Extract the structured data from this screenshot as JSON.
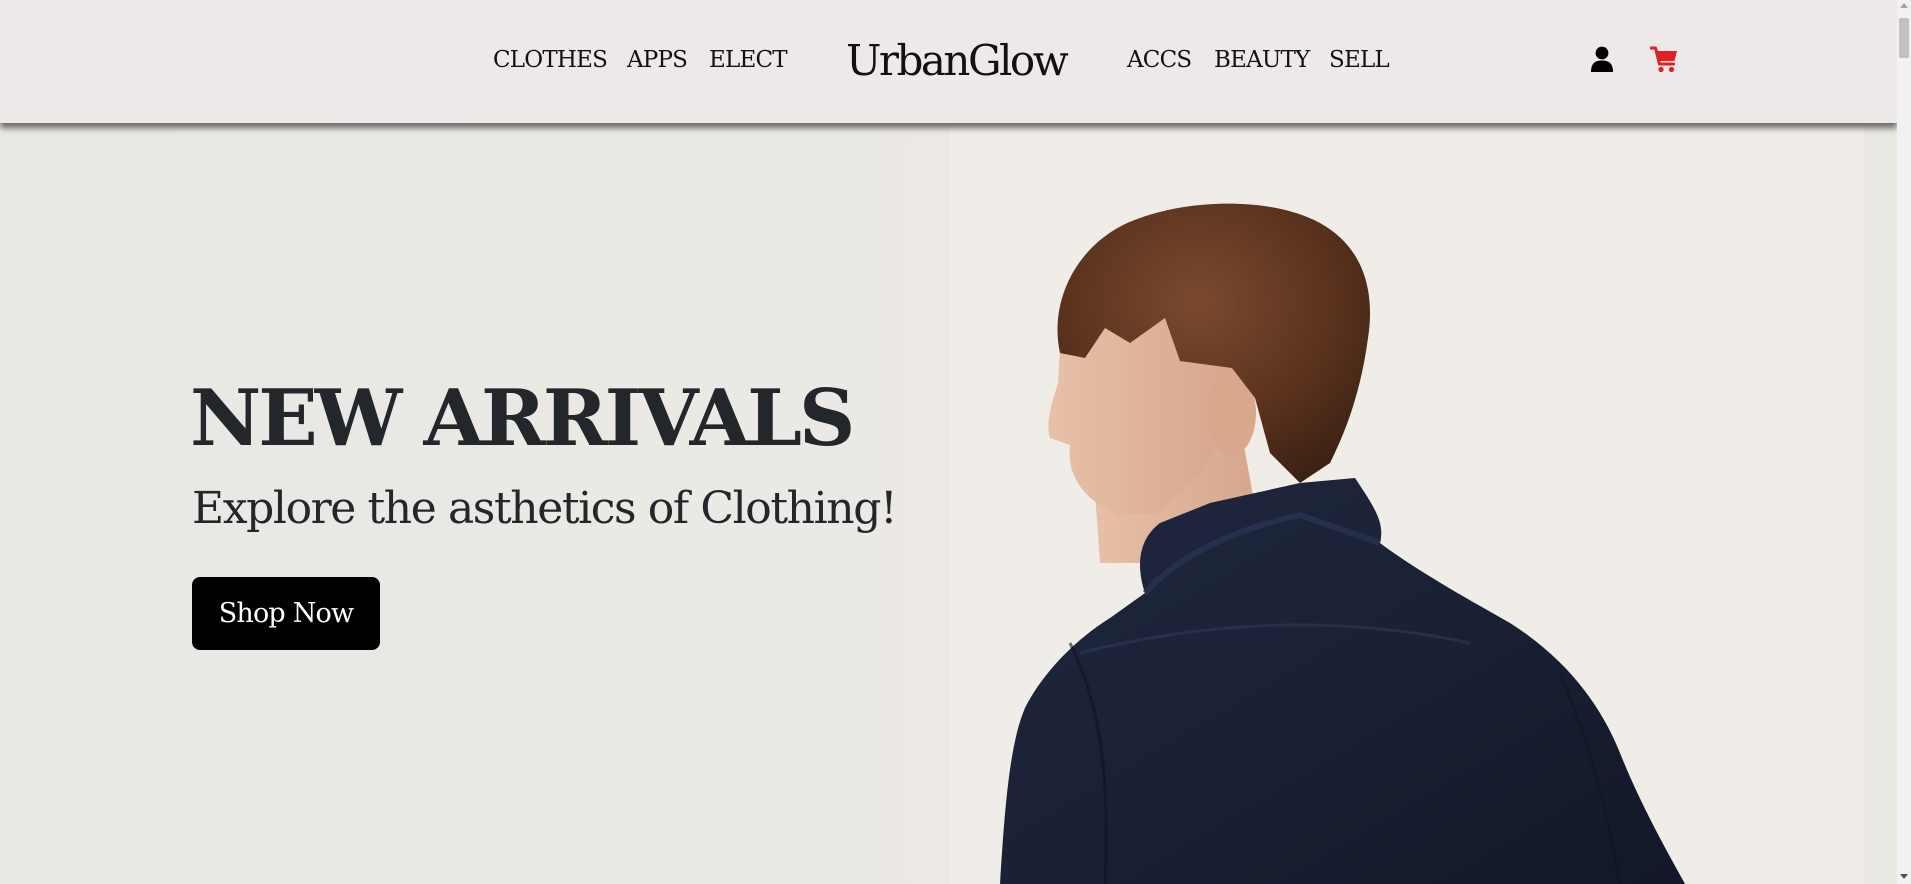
{
  "header": {
    "nav_left": [
      "CLOTHES",
      "APPS",
      "ELECT"
    ],
    "brand": "UrbanGlow",
    "nav_right": [
      "ACCS",
      "BEAUTY",
      "SELL"
    ],
    "icons": {
      "account": "user-icon",
      "cart": "cart-icon"
    },
    "cart_color": "#e31e24"
  },
  "hero": {
    "title": "NEW ARRIVALS",
    "subtitle": "Explore the asthetics of Clothing!",
    "cta_label": "Shop Now",
    "image": "man-in-navy-jacket-photo"
  }
}
